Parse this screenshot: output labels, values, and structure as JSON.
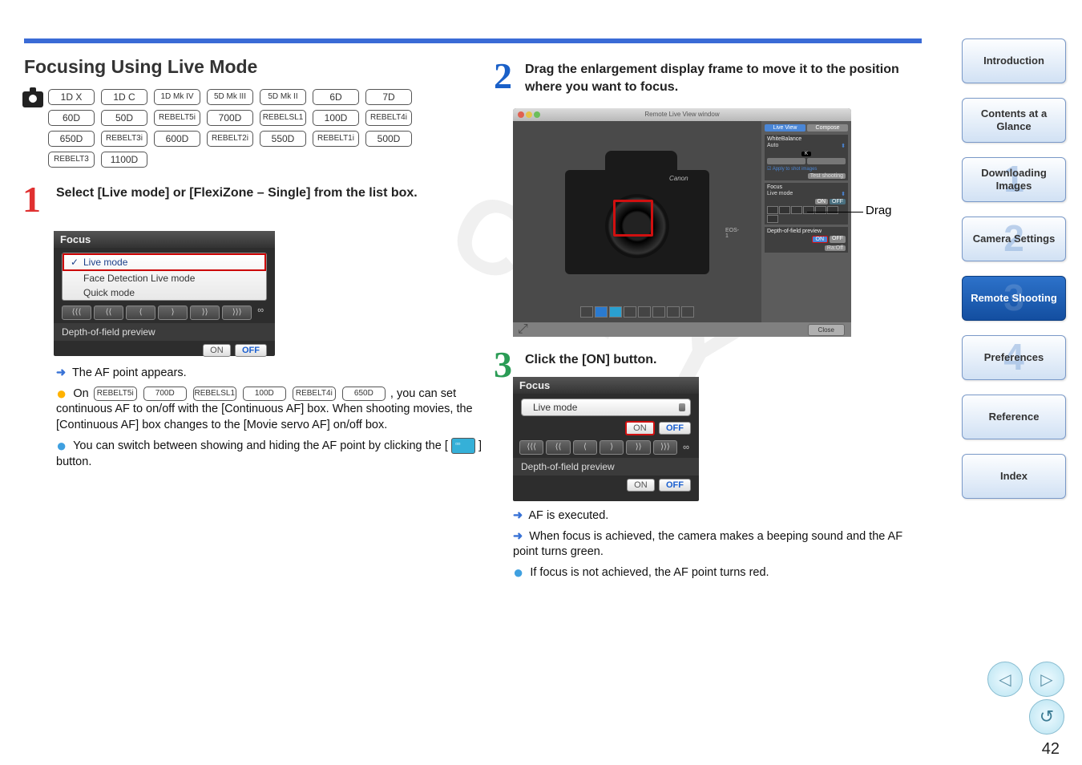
{
  "heading": "Focusing Using Live Mode",
  "camera_models": {
    "row1": [
      "1D X",
      "1D C",
      "1D Mk IV",
      "5D Mk III",
      "5D Mk II",
      "6D",
      "7D"
    ],
    "row2": [
      "60D",
      "50D",
      "REBELT5i",
      "700D",
      "REBELSL1",
      "100D",
      "REBELT4i"
    ],
    "row3": [
      "650D",
      "REBELT3i",
      "600D",
      "REBELT2i",
      "550D",
      "REBELT1i",
      "500D"
    ],
    "row4": [
      "REBELT3",
      "1100D"
    ]
  },
  "step1": {
    "num": "1",
    "text": "Select [Live mode] or [FlexiZone – Single] from the list box."
  },
  "focus_panel1": {
    "title": "Focus",
    "menu": {
      "selected": "Live mode",
      "items": [
        "Face Detection Live mode",
        "Quick mode"
      ]
    },
    "arrows": [
      "⟨⟨⟨",
      "⟨⟨",
      "⟨",
      "⟩",
      "⟩⟩",
      "⟩⟩⟩"
    ],
    "infinity": "∞",
    "depth_label": "Depth-of-field preview",
    "on": "ON",
    "off": "OFF"
  },
  "bullets1": {
    "b1": "The AF point appears.",
    "b2_prefix": "On ",
    "b2_models": [
      "REBELT5i",
      "700D",
      "REBELSL1",
      "100D",
      "REBELT4i",
      "650D"
    ],
    "b2_suffix1": ", you can set continuous AF to on/off with the [Continuous AF] box. When shooting movies, the [Continuous AF] box changes to the [Movie servo AF] on/off box.",
    "b3_a": "You can switch between showing and hiding the AF point by clicking the [",
    "b3_b": "] button."
  },
  "step2": {
    "num": "2",
    "text": "Drag the enlargement display frame to move it to the position where you want to focus."
  },
  "liveview": {
    "window_title": "Remote Live View window",
    "tabs": {
      "live": "Live View",
      "compose": "Compose"
    },
    "wb_label": "WhiteBalance",
    "wb_value": "Auto",
    "apply_checkbox": "Apply to shot images",
    "test_btn": "Test shooting",
    "section_focus": "Focus",
    "live_mode": "Live mode",
    "depth_label": "Depth-of-field preview",
    "on": "ON",
    "off": "OFF",
    "ratio": "Ra:Off",
    "close": "Close",
    "cam_brand": "Canon",
    "cam_model": "EOS-1"
  },
  "drag_label": "Drag",
  "copy_watermark": "COPY",
  "step3": {
    "num": "3",
    "text": "Click the [ON] button."
  },
  "focus_panel3": {
    "title": "Focus",
    "mode": "Live mode",
    "on": "ON",
    "off": "OFF",
    "arrows": [
      "⟨⟨⟨",
      "⟨⟨",
      "⟨",
      "⟩",
      "⟩⟩",
      "⟩⟩⟩"
    ],
    "infinity": "∞",
    "depth_label": "Depth-of-field preview"
  },
  "bullets3": {
    "b1": "AF is executed.",
    "b2": "When focus is achieved, the camera makes a beeping sound and the AF point turns green.",
    "b3": "If focus is not achieved, the AF point turns red."
  },
  "sidebar": {
    "intro": "Introduction",
    "contents": "Contents at a Glance",
    "download": "Downloading Images",
    "camera": "Camera Settings",
    "remote": "Remote Shooting",
    "prefs": "Preferences",
    "reference": "Reference",
    "index": "Index",
    "wm": {
      "d1": "1",
      "d2": "2",
      "d3": "3",
      "d4": "4"
    }
  },
  "nav": {
    "prev": "◁",
    "next": "▷",
    "undo": "↺"
  },
  "page_number": "42"
}
